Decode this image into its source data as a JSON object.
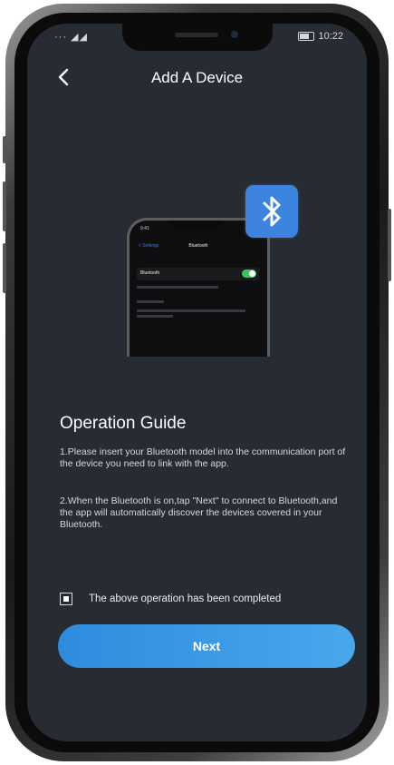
{
  "status_bar": {
    "signal": "··· ◢◢",
    "time": "10:22"
  },
  "header": {
    "title": "Add A Device"
  },
  "illustration": {
    "mini_phone": {
      "time": "9:41",
      "back": "< Settings",
      "title": "Bluetooth",
      "row_label": "Bluetooth",
      "toggle_on": true
    },
    "badge_icon": "bluetooth-icon"
  },
  "guide": {
    "title": "Operation Guide",
    "step1": "1.Please insert your Bluetooth model into the communication port of the device you need to link with the app.",
    "step2": "2.When the Bluetooth is on,tap \"Next\" to connect to Bluetooth,and the app will automatically discover the devices covered in your Bluetooth."
  },
  "confirm": {
    "checked": true,
    "label": "The above operation has been completed"
  },
  "next_button": {
    "label": "Next"
  },
  "colors": {
    "screen_bg": "#272b33",
    "accent": "#3d84e0",
    "button_start": "#2d8cde",
    "button_end": "#49a7ee",
    "toggle_on": "#38c55a"
  }
}
